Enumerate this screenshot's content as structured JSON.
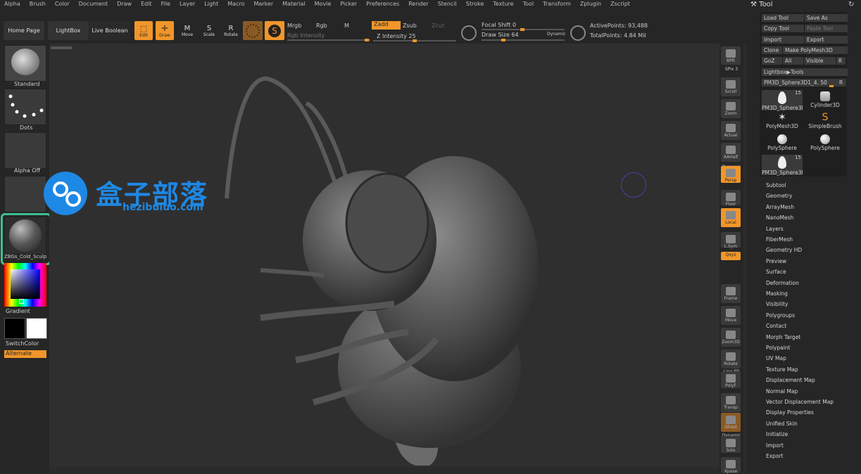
{
  "menubar": [
    "Alpha",
    "Brush",
    "Color",
    "Document",
    "Draw",
    "Edit",
    "File",
    "Layer",
    "Light",
    "Macro",
    "Marker",
    "Material",
    "Movie",
    "Picker",
    "Preferences",
    "Render",
    "Stencil",
    "Stroke",
    "Texture",
    "Tool",
    "Transform",
    "Zplugin",
    "Zscript"
  ],
  "topbar": {
    "home_page": "Home Page",
    "lightbox": "LightBox",
    "live_boolean": "Live Boolean",
    "edit": "Edit",
    "draw": "Draw",
    "move": "Move",
    "scale": "Scale",
    "rotate": "Rotate",
    "mrgb": "Mrgb",
    "rgb": "Rgb",
    "m": "M",
    "rgb_intensity": "Rgb Intensity",
    "zadd": "Zadd",
    "zsub": "Zsub",
    "zcut": "Zcut",
    "z_intensity_label": "Z Intensity",
    "z_intensity_value": "25",
    "focal_shift_label": "Focal Shift",
    "focal_shift_value": "0",
    "draw_size_label": "Draw Size",
    "draw_size_value": "64",
    "dynamic": "Dynamic",
    "active_points": "ActivePoints: 93,488",
    "total_points": "TotalPoints: 4.84 Mil"
  },
  "left_shelf": {
    "brush": "Standard",
    "stroke": "Dots",
    "alpha": "Alpha Off",
    "material": "ZBGs_Cold_Sculpt",
    "gradient": "Gradient",
    "switch_color": "SwitchColor",
    "alternate": "Alternate"
  },
  "watermark": {
    "title": "盒子部落",
    "url": "hezibuluo.com"
  },
  "right_shelf": [
    {
      "label": "BPR"
    },
    {
      "label": "SPix 3"
    },
    {
      "label": "Scroll"
    },
    {
      "label": "Zoom"
    },
    {
      "label": "Actual"
    },
    {
      "label": "AAHalf"
    },
    {
      "label": "Dynamic"
    },
    {
      "label": "Persp"
    },
    {
      "label": "Floor"
    },
    {
      "label": "Local"
    },
    {
      "label": "L.Sym"
    },
    {
      "label": "Qxyz"
    },
    {
      "label": "Frame"
    },
    {
      "label": "Move"
    },
    {
      "label": "Zoom3D"
    },
    {
      "label": "Rotate"
    },
    {
      "label": "Line Fill"
    },
    {
      "label": "PolyF"
    },
    {
      "label": "Transp"
    },
    {
      "label": "Ghost"
    },
    {
      "label": "Dynamic"
    },
    {
      "label": "Solo"
    },
    {
      "label": "Xpose"
    }
  ],
  "tool_panel": {
    "title": "Tool",
    "load_tool": "Load Tool",
    "save_as": "Save As",
    "copy_tool": "Copy Tool",
    "paste_tool": "Paste Tool",
    "import": "Import",
    "export": "Export",
    "clone": "Clone",
    "make_polymesh": "Make PolyMesh3D",
    "goz": "GoZ",
    "all": "All",
    "visible": "Visible",
    "r": "R",
    "lightbox_tools": "Lightbox▶Tools",
    "current_tool": "PM3D_Sphere3D1_4. 50",
    "tools": [
      {
        "name": "PM3D_Sphere3D",
        "count": "15"
      },
      {
        "name": "Cylinder3D",
        "count": ""
      },
      {
        "name": "PolyMesh3D",
        "count": ""
      },
      {
        "name": "SimpleBrush",
        "count": ""
      },
      {
        "name": "PolySphere",
        "count": ""
      },
      {
        "name": "PolySphere",
        "count": ""
      },
      {
        "name": "PM3D_Sphere3D",
        "count": "15"
      }
    ],
    "menu": [
      "Subtool",
      "Geometry",
      "ArrayMesh",
      "NanoMesh",
      "Layers",
      "FiberMesh",
      "Geometry HD",
      "Preview",
      "Surface",
      "Deformation",
      "Masking",
      "Visibility",
      "Polygroups",
      "Contact",
      "Morph Target",
      "Polypaint",
      "UV Map",
      "Texture Map",
      "Displacement Map",
      "Normal Map",
      "Vector Displacement Map",
      "Display Properties",
      "Unified Skin",
      "Initialize",
      "Import",
      "Export"
    ]
  },
  "colors": {
    "accent": "#f0962a",
    "material_highlight": "#3fbf8f",
    "watermark_blue": "#1e88e5"
  }
}
